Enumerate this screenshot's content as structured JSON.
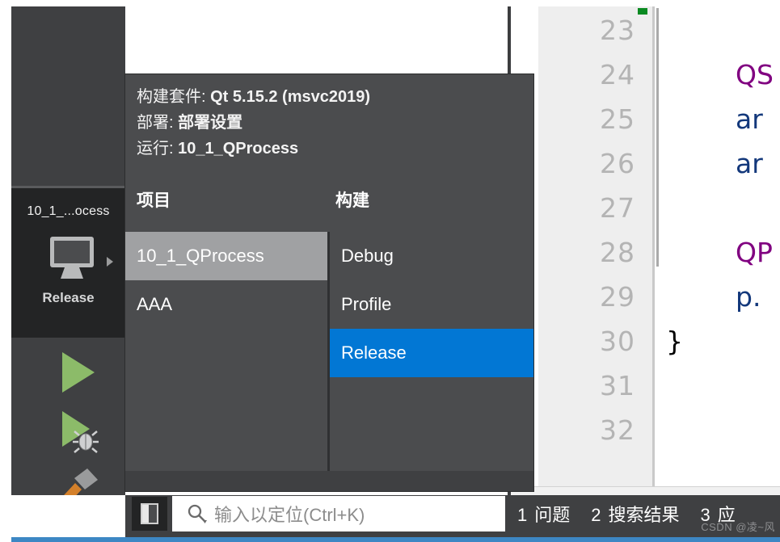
{
  "sidebar": {
    "kit_selector": {
      "project_label": "10_1_...ocess",
      "config_label": "Release",
      "monitor_icon": "desktop-monitor-icon",
      "arrow_icon": "chevron-right-icon"
    },
    "buttons": [
      {
        "name": "run-button",
        "icon": "play-triangle-icon",
        "tooltip": "Run"
      },
      {
        "name": "debug-button",
        "icon": "debug-bug-icon",
        "tooltip": "Start Debugging"
      },
      {
        "name": "build-button",
        "icon": "hammer-icon",
        "tooltip": "Build"
      }
    ]
  },
  "popup": {
    "summary": [
      {
        "label": "构建套件: ",
        "value": "Qt 5.15.2 (msvc2019)"
      },
      {
        "label": "部署: ",
        "value": "部署设置"
      },
      {
        "label": "运行: ",
        "value": "10_1_QProcess"
      }
    ],
    "headers": {
      "projects": "项目",
      "builds": "构建"
    },
    "projects": [
      {
        "label": "10_1_QProcess",
        "state": "hover"
      },
      {
        "label": "AAA",
        "state": "normal"
      }
    ],
    "builds": [
      {
        "label": "Debug",
        "state": "normal"
      },
      {
        "label": "Profile",
        "state": "normal"
      },
      {
        "label": "Release",
        "state": "selected"
      }
    ],
    "colors": {
      "background": "#4b4c4e",
      "hover": "#a0a1a3",
      "selected": "#0277d4"
    }
  },
  "editor": {
    "line_numbers": [
      "23",
      "24",
      "25",
      "26",
      "27",
      "28",
      "29",
      "30",
      "31",
      "32"
    ],
    "code_lines": [
      {
        "line": "24",
        "text": "QS",
        "color": "#800080"
      },
      {
        "line": "25",
        "text": "ar",
        "color": "#13387b"
      },
      {
        "line": "26",
        "text": "ar",
        "color": "#13387b"
      },
      {
        "line": "28",
        "text": "QP",
        "color": "#800080"
      },
      {
        "line": "29",
        "text": "p.",
        "color": "#13387b"
      },
      {
        "line": "30",
        "text": "}",
        "color": "#000000"
      }
    ],
    "gutter_marker_color": "#0a8a21"
  },
  "bottom": {
    "sidebar_toggle_icon": "sidebar-panel-icon",
    "locator": {
      "icon": "search-icon",
      "placeholder": "输入以定位(Ctrl+K)",
      "value": ""
    },
    "output_tabs": [
      {
        "num": "1",
        "label": "问题"
      },
      {
        "num": "2",
        "label": "搜索结果"
      },
      {
        "num": "3",
        "label": "应"
      }
    ],
    "accent_color": "#3d87c4"
  },
  "watermark": "CSDN @凌~风"
}
